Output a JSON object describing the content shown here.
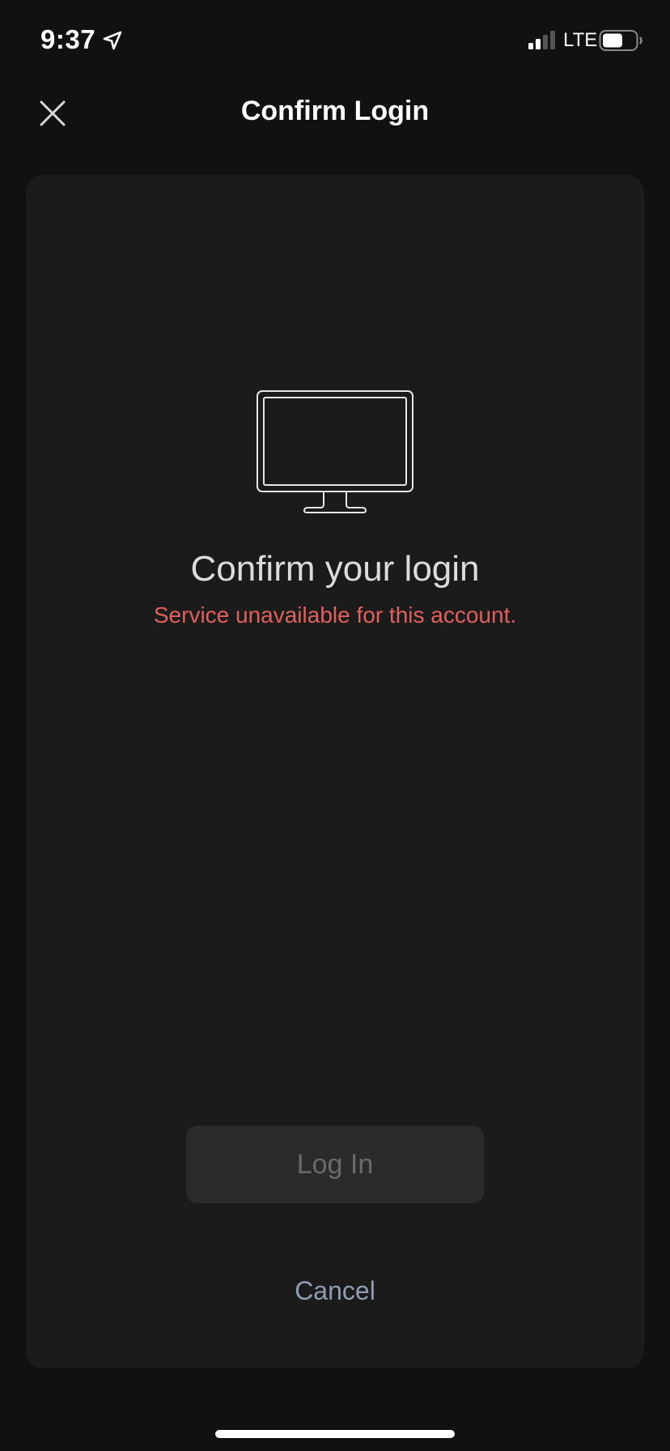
{
  "status_bar": {
    "time": "9:37",
    "network": "LTE",
    "icons": [
      "location-arrow-icon",
      "signal-icon",
      "battery-icon"
    ]
  },
  "header": {
    "title": "Confirm Login",
    "close_icon": "close-icon"
  },
  "card": {
    "icon": "monitor-icon",
    "heading": "Confirm your login",
    "error_message": "Service unavailable for this account.",
    "login_label": "Log In",
    "login_enabled": false,
    "cancel_label": "Cancel"
  },
  "colors": {
    "background": "#111111",
    "card": "#1b1b1b",
    "error": "#e0605c",
    "button_disabled_bg": "#2b2b2b",
    "button_disabled_text": "#6a6a6a",
    "cancel": "#8f9db3"
  }
}
